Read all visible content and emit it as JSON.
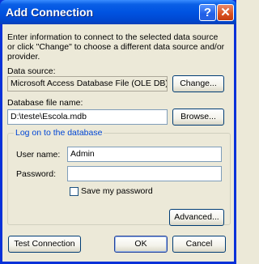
{
  "window": {
    "title": "Add Connection",
    "help_glyph": "?",
    "close_glyph": "✕"
  },
  "intro_text": "Enter information to connect to the selected data source or click \"Change\" to choose a different data source and/or provider.",
  "data_source": {
    "label": "Data source:",
    "value": "Microsoft Access Database File (OLE DB)",
    "change_label": "Change..."
  },
  "database_file": {
    "label": "Database file name:",
    "value": "D:\\teste\\Escola.mdb",
    "browse_label": "Browse..."
  },
  "logon": {
    "legend": "Log on to the database",
    "user_label": "User name:",
    "user_value": "Admin",
    "password_label": "Password:",
    "password_value": "",
    "save_password_label": "Save my password",
    "save_password_checked": false
  },
  "buttons": {
    "advanced": "Advanced...",
    "test_connection": "Test Connection",
    "ok": "OK",
    "cancel": "Cancel"
  }
}
